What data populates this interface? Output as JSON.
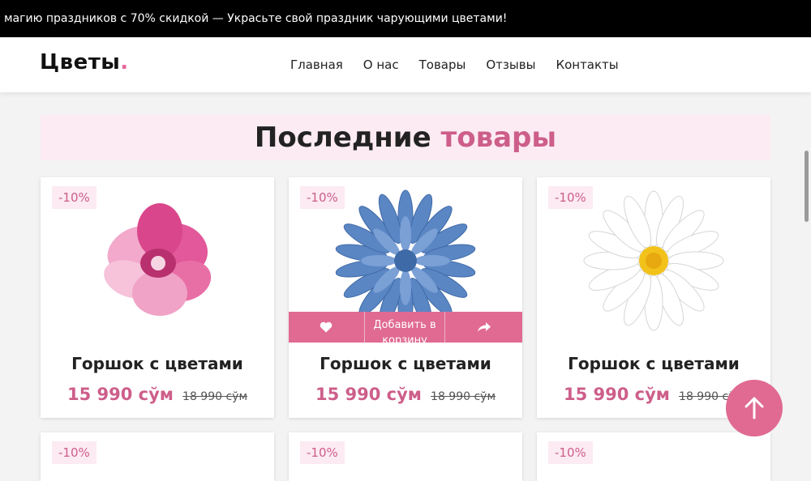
{
  "promo": {
    "text": "магию праздников с 70% скидкой — Украсьте свой праздник чарующими цветами!"
  },
  "header": {
    "logo_text": "Цветы",
    "logo_dot": ".",
    "nav": [
      {
        "label": "Главная"
      },
      {
        "label": "О нас"
      },
      {
        "label": "Товары"
      },
      {
        "label": "Отзывы"
      },
      {
        "label": "Контакты"
      }
    ]
  },
  "section": {
    "title_main": "Последние",
    "title_accent": "товары"
  },
  "products": [
    {
      "discount": "-10%",
      "name": "Горшок с цветами",
      "price": "15 990 сўм",
      "old_price": "18 990 сўм",
      "image": "pink-magnolia",
      "accent": "#e8659a"
    },
    {
      "discount": "-10%",
      "name": "Горшок с цветами",
      "price": "15 990 сўм",
      "old_price": "18 990 сўм",
      "image": "blue-dahlia",
      "accent": "#5b86c4"
    },
    {
      "discount": "-10%",
      "name": "Горшок с цветами",
      "price": "15 990 сўм",
      "old_price": "18 990 сўм",
      "image": "white-daisy",
      "accent": "#f2c21a"
    }
  ],
  "second_row": [
    {
      "discount": "-10%"
    },
    {
      "discount": "-10%"
    },
    {
      "discount": "-10%"
    }
  ],
  "hover_actions": {
    "add_to_cart": "Добавить в корзину"
  },
  "icons": {
    "like": "heart-icon",
    "share": "share-icon",
    "scroll_top": "arrow-up-icon"
  },
  "colors": {
    "brand": "#e06a92",
    "accent_text": "#cd5e8a",
    "title_bg": "#fcebf2",
    "topbar_bg": "#000000"
  }
}
